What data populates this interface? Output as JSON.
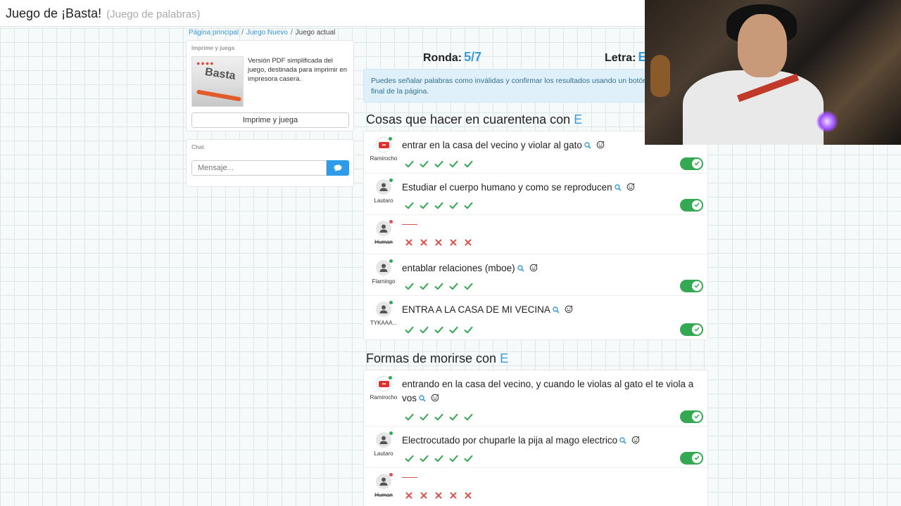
{
  "header": {
    "title": "Juego de ¡Basta!",
    "subtitle": "(Juego de palabras)"
  },
  "breadcrumb": {
    "home": "Página principal",
    "new_game": "Juego Nuevo",
    "current": "Juego actual"
  },
  "print_panel": {
    "heading": "Imprime y juega",
    "description": "Versión PDF simplificada del juego, destinada para imprimir en impresora casera.",
    "thumb_word": "Basta",
    "button_label": "Imprime y juega"
  },
  "chat": {
    "heading": "Chat",
    "placeholder": "Mensaje...",
    "send_icon": "chat-bubble-icon"
  },
  "game": {
    "round_label": "Ronda:",
    "round_value": "5/7",
    "letter_label": "Letra:",
    "letter_value": "E"
  },
  "alert": {
    "text": "Puedes señalar palabras como inválidas y confirmar los resultados usando un botón al final de la página."
  },
  "colors": {
    "accent": "#3a9ad9",
    "success": "#34a853",
    "error": "#d9534f",
    "online": "#34a853",
    "offline": "#d9534f"
  },
  "sections": [
    {
      "title": "Cosas que hacer en cuarentena con",
      "letter": "E",
      "answers": [
        {
          "player": "Ramirocho",
          "logo": true,
          "online": true,
          "text": "entrar en la casa del vecino y violar al gato",
          "valid": true,
          "struck": false
        },
        {
          "player": "Lautaro",
          "logo": false,
          "online": true,
          "text": "Estudiar el cuerpo humano y como se reproducen",
          "valid": true,
          "struck": false
        },
        {
          "player": "Human",
          "logo": false,
          "online": false,
          "text": "",
          "valid": false,
          "struck": true
        },
        {
          "player": "Flamingo",
          "logo": false,
          "online": true,
          "text": "entablar relaciones (mboe)",
          "valid": true,
          "struck": false
        },
        {
          "player": "TYKAAA...",
          "logo": false,
          "online": true,
          "text": "ENTRA A LA CASA DE MI VECINA",
          "valid": true,
          "struck": false
        }
      ]
    },
    {
      "title": "Formas de morirse con",
      "letter": "E",
      "answers": [
        {
          "player": "Ramirocho",
          "logo": true,
          "online": true,
          "text": "entrando en la casa del vecino, y cuando le violas al gato el te viola a vos",
          "valid": true,
          "struck": false
        },
        {
          "player": "Lautaro",
          "logo": false,
          "online": true,
          "text": "Electrocutado por chuparle la pija al mago electrico",
          "valid": true,
          "struck": false
        },
        {
          "player": "Human",
          "logo": false,
          "online": false,
          "text": "",
          "valid": false,
          "struck": true
        }
      ]
    }
  ]
}
